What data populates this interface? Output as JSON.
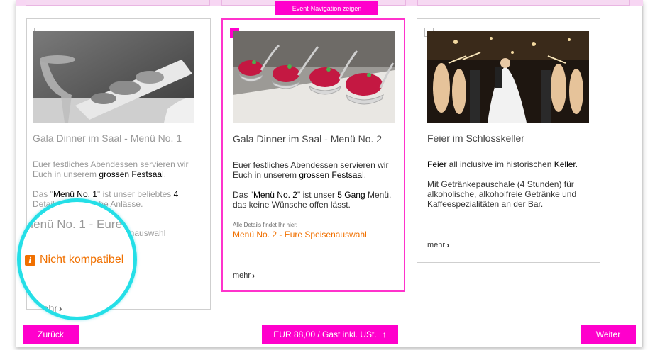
{
  "event_nav": {
    "label": "Event-Navigation zeigen"
  },
  "cards": [
    {
      "title": "Gala Dinner im Saal - Menü No. 1",
      "p1_a": "Euer festliches Abendessen servieren wir Euch in unserem ",
      "p1_b": "grossen Festsaal",
      "p1_c": ".",
      "p2_a": "Das \"",
      "p2_b": "Menü No. 1",
      "p2_c": "\" ist unser beliebtes ",
      "p2_d": "4",
      "p2_e": "Details findet",
      "p2_f": "stliche Anlässe.",
      "partial_link": "enauswahl",
      "checked": false
    },
    {
      "title": "Gala Dinner im Saal - Menü No. 2",
      "p1_a": "Euer festliches Abendessen servieren wir Euch in unserem ",
      "p1_b": "grossen Festsaal",
      "p1_c": ".",
      "p2_a": "Das \"",
      "p2_b": "Menü No. 2",
      "p2_c": "\" ist unser ",
      "p2_d": "5 Gang",
      "p2_e": " Menü, das keine Wünsche offen lässt.",
      "details_label": "Alle Details findet Ihr hier:",
      "link": "Menü No. 2 - Eure Speisenauswahl",
      "more": "mehr",
      "checked": true
    },
    {
      "title": "Feier im Schlosskeller",
      "p1_a": "Feier",
      "p1_b": " all inclusive im historischen ",
      "p1_c": "Keller",
      "p1_d": ".",
      "p2": "Mit Getränkepauschale (4 Stunden) für alkoholische, alkoholfreie Getränke und Kaffeespezialitäten an der Bar.",
      "more": "mehr",
      "checked": false
    }
  ],
  "overlay": {
    "title": "Menü No. 1 - Eure",
    "warning": "Nicht kompatibel",
    "more": "mehr"
  },
  "footer": {
    "back": "Zurück",
    "price": "EUR 88,00 / Gast inkl. USt.",
    "next": "Weiter"
  },
  "colors": {
    "accent": "#ff00cc",
    "warning": "#f07000",
    "highlight": "#24dfe7"
  }
}
